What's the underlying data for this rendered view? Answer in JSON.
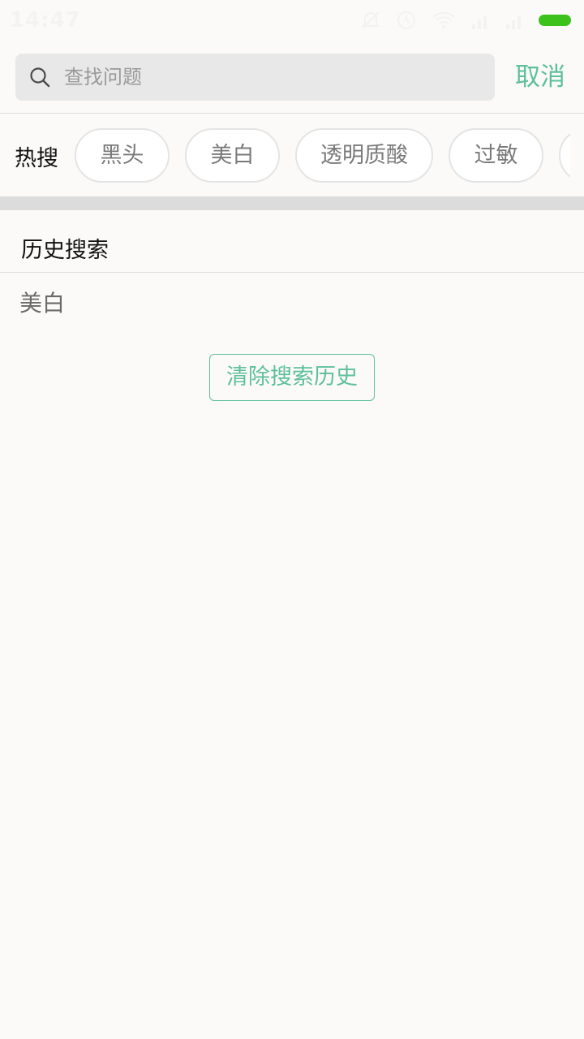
{
  "status_bar": {
    "time": "14:47",
    "icons": [
      "alarm-off-icon",
      "clock-icon",
      "wifi-icon",
      "signal-icon",
      "signal-icon"
    ],
    "battery_color": "#3cc21a"
  },
  "search": {
    "placeholder": "查找问题",
    "value": "",
    "cancel_label": "取消"
  },
  "hot_search": {
    "label": "热搜",
    "tags": [
      "黑头",
      "美白",
      "透明质酸",
      "过敏"
    ]
  },
  "history": {
    "title": "历史搜索",
    "items": [
      "美白"
    ],
    "clear_label": "清除搜索历史"
  },
  "colors": {
    "accent": "#5ec09a",
    "background": "#fbfaf8"
  }
}
